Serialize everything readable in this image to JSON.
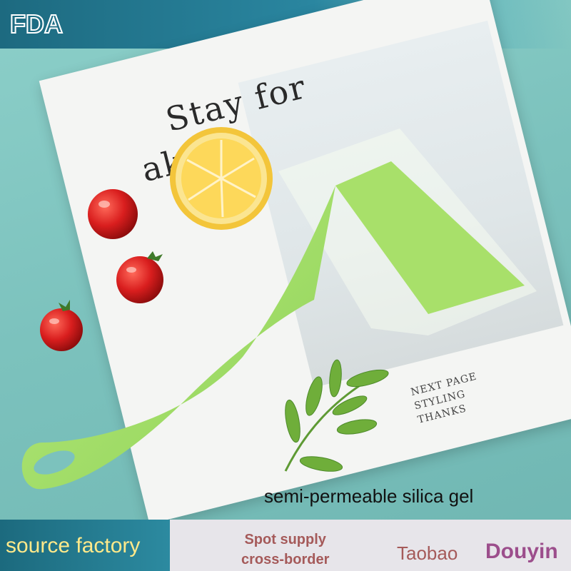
{
  "logo": {
    "text": "FDA"
  },
  "magazine": {
    "headline_line1": "Stay for",
    "headline_line2": "akfast",
    "footer_line1": "NEXT PAGE",
    "footer_line2": "STYLING",
    "footer_line3": "THANKS"
  },
  "labels": {
    "caption": "semi-permeable silica gel",
    "source": "source factory",
    "spot_line1": "Spot supply",
    "spot_line2": "cross-border",
    "taobao": "Taobao",
    "douyin": "Douyin"
  },
  "colors": {
    "background": "#7fc5c1",
    "spatula": "#a8e06a",
    "accent_band": "#1d6a80",
    "source_text": "#ffe98a",
    "douyin_text": "#9c4e8c"
  }
}
